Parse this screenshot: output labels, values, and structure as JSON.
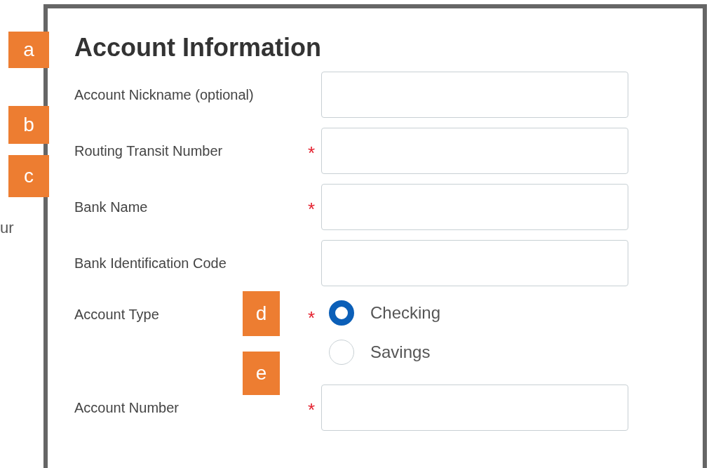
{
  "side_text": "ur",
  "callouts": [
    {
      "label": "a"
    },
    {
      "label": "b"
    },
    {
      "label": "c"
    },
    {
      "label": "d"
    },
    {
      "label": "e"
    }
  ],
  "form": {
    "title": "Account Information",
    "fields": [
      {
        "kind": "text",
        "label": "Account Nickname (optional)"
      },
      {
        "kind": "text",
        "label": "Routing Transit Number",
        "required_mark": "*"
      },
      {
        "kind": "text",
        "label": "Bank Name",
        "required_mark": "*"
      },
      {
        "kind": "text",
        "label": "Bank Identification Code"
      },
      {
        "kind": "radio",
        "label": "Account Type",
        "required_mark": "*",
        "options": [
          {
            "label": "Checking",
            "selected": true
          },
          {
            "label": "Savings",
            "selected": false
          }
        ]
      },
      {
        "kind": "text",
        "label": "Account Number",
        "required_mark": "*"
      }
    ]
  }
}
